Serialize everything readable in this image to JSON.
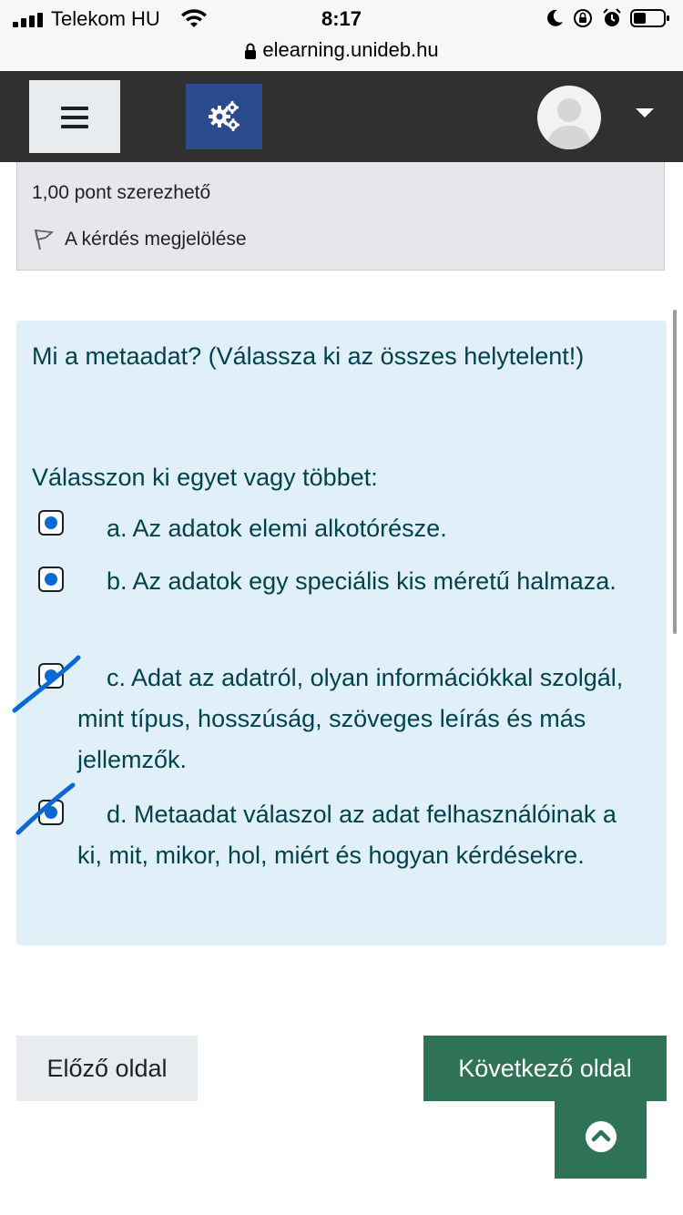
{
  "status_bar": {
    "carrier": "Telekom HU",
    "time": "8:17",
    "url": "elearning.unideb.hu"
  },
  "navbar": {
    "menu_icon": "hamburger-icon",
    "settings_icon": "cogs-icon",
    "user_icon": "user-avatar",
    "dropdown_icon": "caret-down-icon"
  },
  "question_info": {
    "grade": "1,00 pont szerezhető",
    "flag_label": "A kérdés megjelölése"
  },
  "question": {
    "text": "Mi a metaadat? (Válassza ki az összes helytelent!)",
    "prompt": "Válasszon ki egyet vagy többet:",
    "options": [
      {
        "label": "a. Az adatok elemi alkotórésze.",
        "checked": true
      },
      {
        "label": "b. Az adatok egy speciális kis méretű halmaza.",
        "checked": true
      },
      {
        "label": "c. Adat az adatról, olyan információkkal szolgál, mint típus, hosszúság, szöveges leírás és más jellemzők.",
        "checked": true
      },
      {
        "label": "d. Metaadat válaszol az adat felhasználóinak a ki, mit, mikor, hol, miért és hogyan kérdésekre.",
        "checked": true
      }
    ]
  },
  "navigation": {
    "prev_label": "Előző oldal",
    "next_label": "Következő oldal",
    "back_to_top_icon": "chevron-up-circle-icon"
  },
  "colors": {
    "navbar": "#303030",
    "primary": "#2a4b8d",
    "success": "#2e7355",
    "question_bg": "#e1f0f8",
    "question_text": "#00434e",
    "check_fill": "#0a6ad4"
  }
}
